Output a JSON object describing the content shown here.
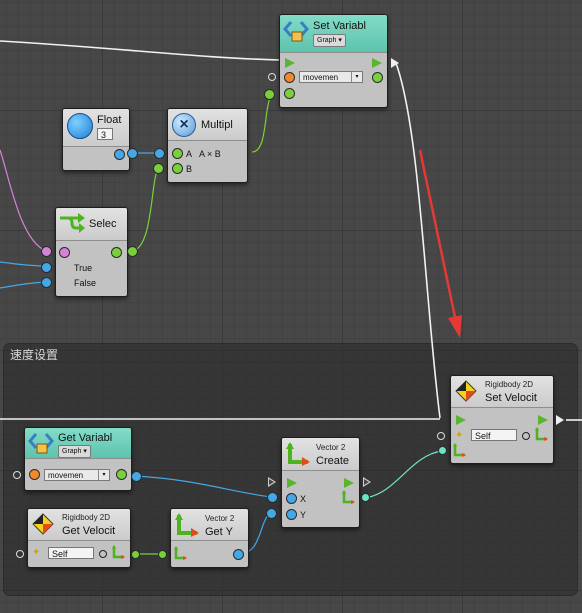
{
  "group": {
    "title": "速度设置"
  },
  "nodes": {
    "set_variable": {
      "title": "Set Variabl",
      "scope": "Graph",
      "variable": "movemen"
    },
    "float": {
      "title": "Float",
      "value": "3"
    },
    "multiply": {
      "title": "Multipl",
      "port_a": "A",
      "formula": "A × B",
      "port_b": "B"
    },
    "select": {
      "title": "Selec",
      "port_true": "True",
      "port_false": "False"
    },
    "set_velocity": {
      "category": "Rigidbody 2D",
      "title": "Set Velocit",
      "target": "Self"
    },
    "get_variable": {
      "title": "Get Variabl",
      "scope": "Graph",
      "variable": "movemen"
    },
    "vector2_create": {
      "category": "Vector 2",
      "title": "Create",
      "port_x": "X",
      "port_y": "Y"
    },
    "get_velocity": {
      "category": "Rigidbody 2D",
      "title": "Get Velocit",
      "target": "Self"
    },
    "get_y": {
      "category": "Vector 2",
      "title": "Get Y"
    }
  },
  "colors": {
    "flow_port": "#7ad03a",
    "float_port": "#45a7e6",
    "vector_port": "#7ad03a",
    "variable_port": "#f08a2c",
    "bool_port": "#d583d6",
    "annotation_arrow": "#e53935",
    "teal_header": "#5ec3ad"
  },
  "icons": [
    "variable-icon",
    "float-circle-icon",
    "multiply-icon",
    "select-icon",
    "rigidbody2d-icon",
    "vector2-icon",
    "dropdown-arrow-icon"
  ]
}
